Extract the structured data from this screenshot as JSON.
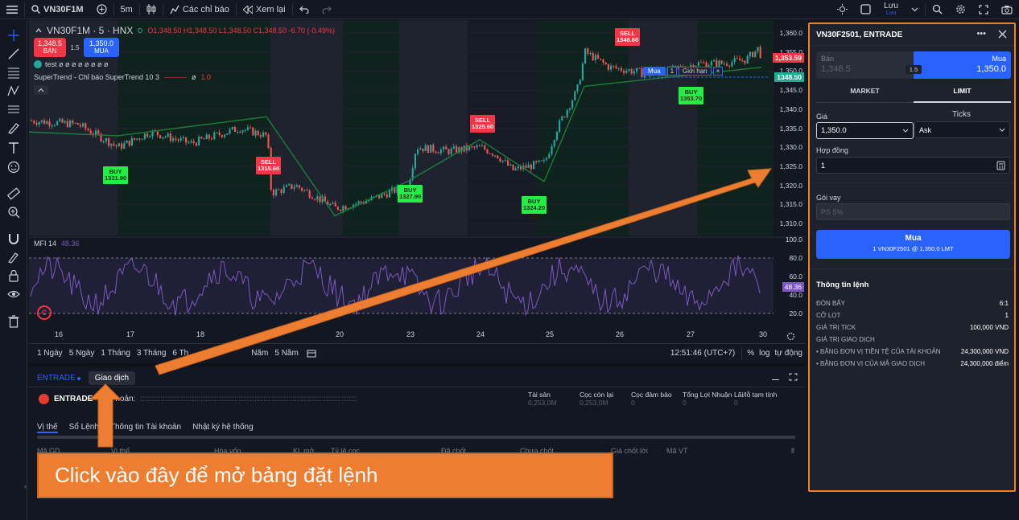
{
  "topbar": {
    "symbol": "VN30F1M",
    "interval": "5m",
    "indicators_label": "Các chỉ báo",
    "replay_label": "Xem lại",
    "save_label": "Lưu",
    "save_sub": "Lưu"
  },
  "legend": {
    "title": "VN30F1M · 5 · HNX",
    "ohlc": "O1,348.50 H1,348.50 L1,348.50 C1,348.50 -6.70 (-0.49%)",
    "sell_price": "1,348.5",
    "sell_label": "BÁN",
    "spread": "1.5",
    "buy_price": "1,350.0",
    "buy_label": "MUA",
    "test_line": "test  ø ø ø ø ø ø ø ø",
    "supertrend": "SuperTrend - Chỉ báo SuperTrend 10 3",
    "supertrend_val": "1.0"
  },
  "chart_data": {
    "type": "line",
    "title": "VN30F1M · 5 · HNX",
    "y_ticks": [
      "1,360.0",
      "1,355.0",
      "1,350.0",
      "1,345.0",
      "1,340.0",
      "1,335.0",
      "1,330.0",
      "1,325.0",
      "1,320.0",
      "1,315.0",
      "1,310.0"
    ],
    "x_ticks": [
      "16",
      "17",
      "18",
      "20",
      "23",
      "24",
      "25",
      "26",
      "27",
      "30"
    ],
    "current_price": "1,353.59",
    "order_line_price": "1348.50",
    "order_line_label": "Mua",
    "order_line_qty": "1",
    "order_line_type": "Giới hạn",
    "signals": [
      {
        "type": "BUY",
        "price": "1331.90"
      },
      {
        "type": "SELL",
        "price": "1315.60"
      },
      {
        "type": "BUY",
        "price": "1327.90"
      },
      {
        "type": "SELL",
        "price": "1325.60"
      },
      {
        "type": "BUY",
        "price": "1324.20"
      },
      {
        "type": "SELL",
        "price": "1348.60"
      },
      {
        "type": "BUY",
        "price": "1353.70"
      }
    ],
    "mfi": {
      "label": "MFI 14",
      "value": "48.36",
      "y_ticks": [
        "100.0",
        "80.0",
        "60.0",
        "40.0",
        "20.0"
      ]
    }
  },
  "rangebar": {
    "ranges": [
      "1 Ngày",
      "5 Ngày",
      "1 Tháng",
      "3 Tháng",
      "6 Th",
      "Năm",
      "5 Năm"
    ],
    "time": "12:51:46 (UTC+7)",
    "percent": "%",
    "log": "log",
    "auto": "tự động"
  },
  "bottom": {
    "broker": "ENTRADE",
    "trade_tab": "Giao dịch",
    "broker_logo_text": "ENTRADE",
    "account_label": "hoản:",
    "stats": [
      {
        "label": "Tài sản",
        "value": "0,253,0M"
      },
      {
        "label": "Cọc còn lại",
        "value": "0,253,0M"
      },
      {
        "label": "Cọc đảm bảo",
        "value": "0"
      },
      {
        "label": "Tổng Lợi Nhuận",
        "value": "0"
      },
      {
        "label": "Lãi/lỗ tạm tính",
        "value": "0"
      }
    ],
    "tabs": [
      "Vị thế",
      "Sổ Lệnh",
      "Thông tin Tài khoản",
      "Nhật ký hệ thống"
    ],
    "columns": [
      "Mã GD",
      "Vị thế",
      "Hòa vốn",
      "KL mở",
      "Tỷ lệ cọc",
      "Đã chốt",
      "Chưa chốt",
      "Giá chốt lời",
      "Mã VT"
    ]
  },
  "panel": {
    "title": "VN30F2501, ENTRADE",
    "sell_label": "Bán",
    "sell_price": "1,348.5",
    "buy_label": "Mua",
    "buy_price": "1,350.0",
    "spread": "1.5",
    "tab_market": "MARKET",
    "tab_limit": "LIMIT",
    "price_label": "Giá",
    "ticks_label": "Ticks",
    "price_value": "1,350.0",
    "ticks_value": "Ask",
    "contract_label": "Hợp đồng",
    "contract_value": "1",
    "loan_label": "Gói vay",
    "loan_placeholder": "PS 5%",
    "submit_label": "Mua",
    "submit_sub": "1 VN30F2501 @ 1,350.0 LMT",
    "info_title": "Thông tin lệnh",
    "info_rows": [
      {
        "label": "ĐÒN BẨY",
        "value": "6:1"
      },
      {
        "label": "CỠ LOT",
        "value": "1"
      },
      {
        "label": "GIÁ TRỊ TICK",
        "value": "100,000 VND"
      },
      {
        "label": "GIÁ TRỊ GIAO DỊCH",
        "value": ""
      },
      {
        "label": "•  BẰNG ĐƠN VỊ TIỀN TỆ CỦA TÀI KHOẢN",
        "value": "24,300,000 VND"
      },
      {
        "label": "•  BẰNG ĐƠN VỊ CỦA MÃ GIAO DỊCH",
        "value": "24,300,000 điểm"
      }
    ]
  },
  "annotation": {
    "text": "Click vào đây để mở bảng đặt lệnh",
    "color": "#ed7d31"
  }
}
